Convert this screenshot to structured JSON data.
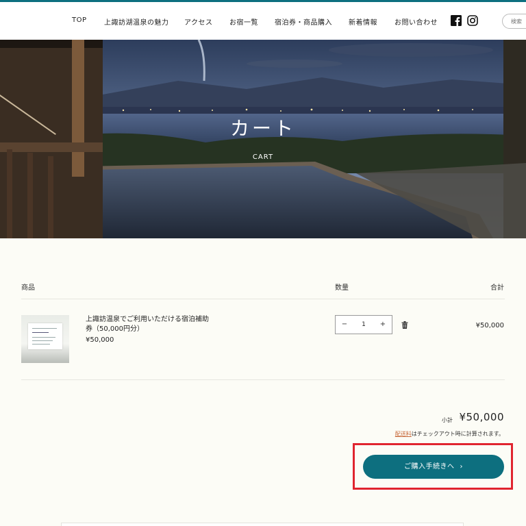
{
  "header": {
    "nav": [
      "TOP",
      "上諏訪湖温泉の魅力",
      "アクセス",
      "お宿一覧",
      "宿泊券・商品購入",
      "新着情報",
      "お問い合わせ"
    ],
    "search_placeholder": "検索",
    "social_icons": [
      "facebook-icon",
      "instagram-icon"
    ]
  },
  "hero": {
    "title": "カート",
    "subtitle": "CART"
  },
  "cart": {
    "columns": {
      "product": "商品",
      "quantity": "数量",
      "total": "合計"
    },
    "items": [
      {
        "name": "上諏訪温泉でご利用いただける宿泊補助券（50,000円分）",
        "price": "¥50,000",
        "quantity": "1",
        "line_total": "¥50,000"
      }
    ],
    "minus": "−",
    "plus": "+"
  },
  "summary": {
    "subtotal_label": "小計",
    "subtotal_value": "¥50,000",
    "shipping_link": "配送料",
    "shipping_note": "はチェックアウト時に計算されます。",
    "checkout_label": "ご購入手続きへ",
    "checkout_chevron": "›"
  },
  "colors": {
    "accent": "#0d6f7f",
    "link": "#c8693a",
    "highlight": "#e0242f",
    "background": "#fcfcf6"
  }
}
